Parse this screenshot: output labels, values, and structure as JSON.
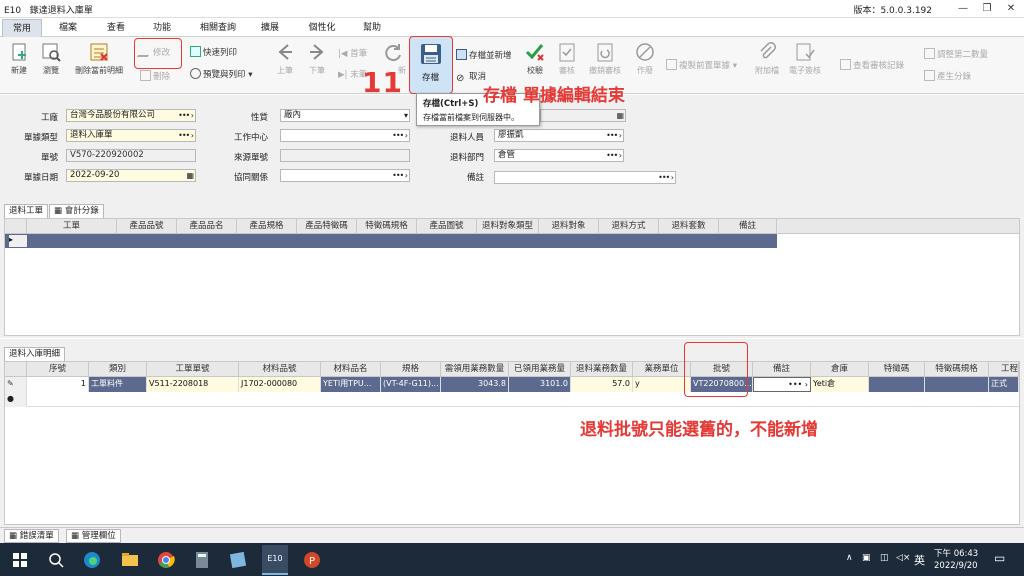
{
  "window": {
    "app_code": "E10",
    "title": "錄達退料入庫單",
    "version": "版本：5.0.0.3.192",
    "minimize": "—",
    "restore": "❐",
    "close": "✕"
  },
  "menu": [
    "常用",
    "檔案",
    "查看",
    "功能",
    "相關查詢",
    "擴展",
    "個性化",
    "幫助"
  ],
  "toolbar": {
    "new": "新建",
    "browse": "瀏覽",
    "delete_current_detail": "刪除當前明細",
    "modify": "修改",
    "delete": "刪除",
    "quick_print": "快速列印",
    "preview_print": "預覽與列印",
    "prev": "上筆",
    "next": "下筆",
    "first": "首筆",
    "last": "末筆",
    "refresh": "新",
    "save": "存檔",
    "save_and_new": "存檔並新增",
    "cancel": "取消",
    "validate": "校驗",
    "approve": "審核",
    "unapprove": "撤銷審核",
    "void": "作廢",
    "copy_prev": "複製前置單據",
    "attach": "附加檔",
    "esign": "電子簽核",
    "view_approval": "查看審核記錄",
    "adjust_qty2": "調整第二數量",
    "generate_lot": "產生分錄"
  },
  "tooltip": {
    "title": "存檔(Ctrl+S)",
    "desc": "存檔當前檔案到伺服器中。"
  },
  "annotations": {
    "step": "11",
    "save_note": "存檔 單據編輯結束",
    "batch_note": "退料批號只能選舊的，不能新增"
  },
  "form": {
    "factory_label": "工廠",
    "factory_value": "台灣今品股份有限公司",
    "doc_type_label": "單據類型",
    "doc_type_value": "退料入庫單",
    "doc_no_label": "單號",
    "doc_no_value": "V570-220920002",
    "doc_date_label": "單據日期",
    "doc_date_value": "2022-09-20",
    "nature_label": "性質",
    "nature_value": "廠內",
    "work_center_label": "工作中心",
    "source_doc_label": "來源單號",
    "collab_label": "協同關係",
    "return_person_label": "退料人員",
    "return_person_value": "廖振凱",
    "return_dept_label": "退料部門",
    "return_dept_value": "倉管",
    "remark_label": "備註",
    "dots": "•••",
    "arrow": "›"
  },
  "upper_tabs": [
    "退料工單",
    "會計分錄"
  ],
  "upper_grid": {
    "headers": [
      "工單",
      "產品品號",
      "產品品名",
      "產品規格",
      "產品特徵碼",
      "特徵碼規格",
      "產品圖號",
      "退料對象類型",
      "退料對象",
      "退料方式",
      "退料套數",
      "備註"
    ]
  },
  "lower_tabs": [
    "退料入庫明細"
  ],
  "lower_grid": {
    "headers": [
      "序號",
      "類別",
      "工單單號",
      "材料品號",
      "材料品名",
      "規格",
      "需領用業務數量",
      "已領用業務量",
      "退料業務數量",
      "業務單位",
      "批號",
      "備註",
      "倉庫",
      "特徵碼",
      "特徵碼規格",
      "工程"
    ],
    "rows": [
      [
        "1",
        "工單料件",
        "V511-2208018",
        "J1702-000080",
        "YETI用TPU...",
        "(VT-4F-G11)...",
        "3043.8",
        "3101.0",
        "57.0",
        "y",
        "VT22070800...",
        "",
        "Yeti倉",
        "",
        "",
        "正式"
      ]
    ]
  },
  "bottom_tabs": [
    "錯誤清單",
    "管理欄位"
  ],
  "taskbar": {
    "ime": "英",
    "time": "下午 06:43",
    "date": "2022/9/20"
  }
}
